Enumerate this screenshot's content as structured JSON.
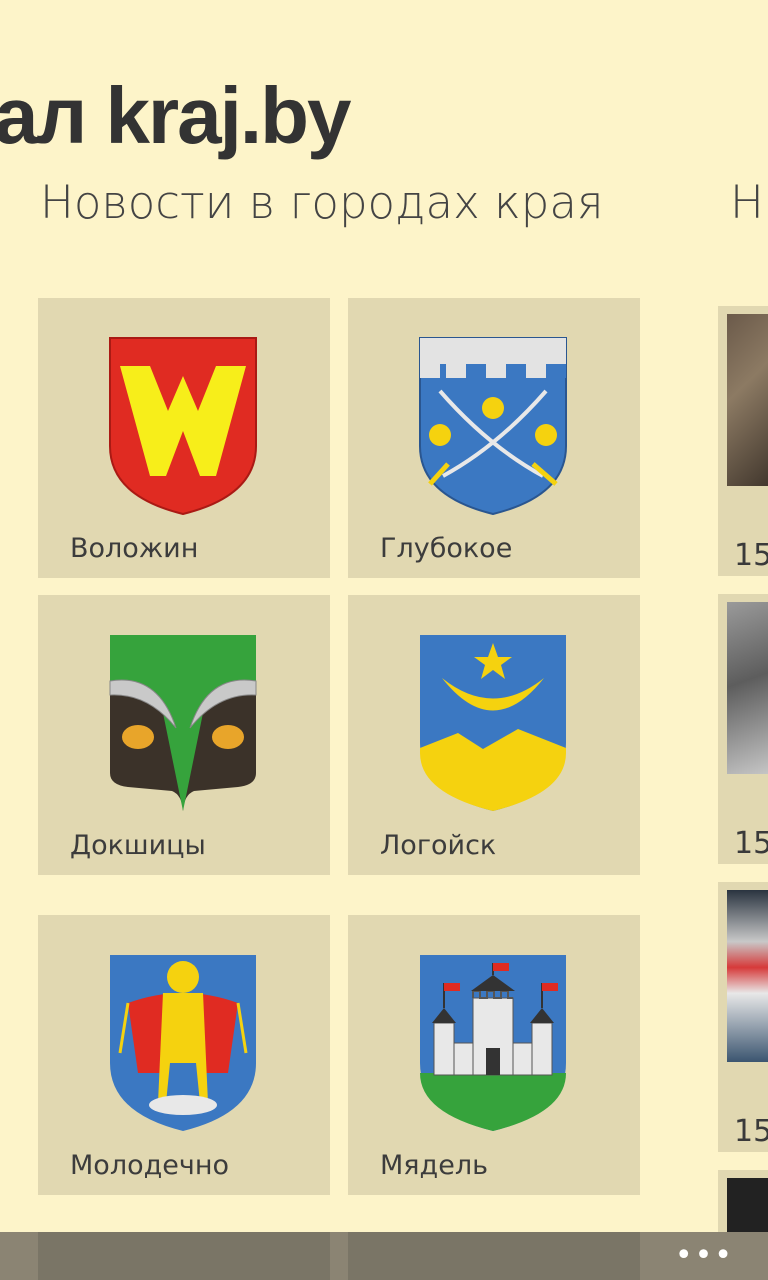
{
  "header": {
    "title": "ал kraj.by"
  },
  "sections": {
    "cities_title": "Новости в городах края",
    "next_title_peek": "Н"
  },
  "cities": [
    {
      "label": "Воложин"
    },
    {
      "label": "Глубокое"
    },
    {
      "label": "Докшицы"
    },
    {
      "label": "Логойск"
    },
    {
      "label": "Молодечно"
    },
    {
      "label": "Мядель"
    }
  ],
  "news_peek": [
    {
      "date": "15"
    },
    {
      "date": "15"
    },
    {
      "date": "15"
    }
  ],
  "appbar": {
    "more_label": "•••"
  },
  "colors": {
    "background": "#fdf4c9",
    "tile": "#e1d8b1",
    "appbar": "#8b8473"
  }
}
